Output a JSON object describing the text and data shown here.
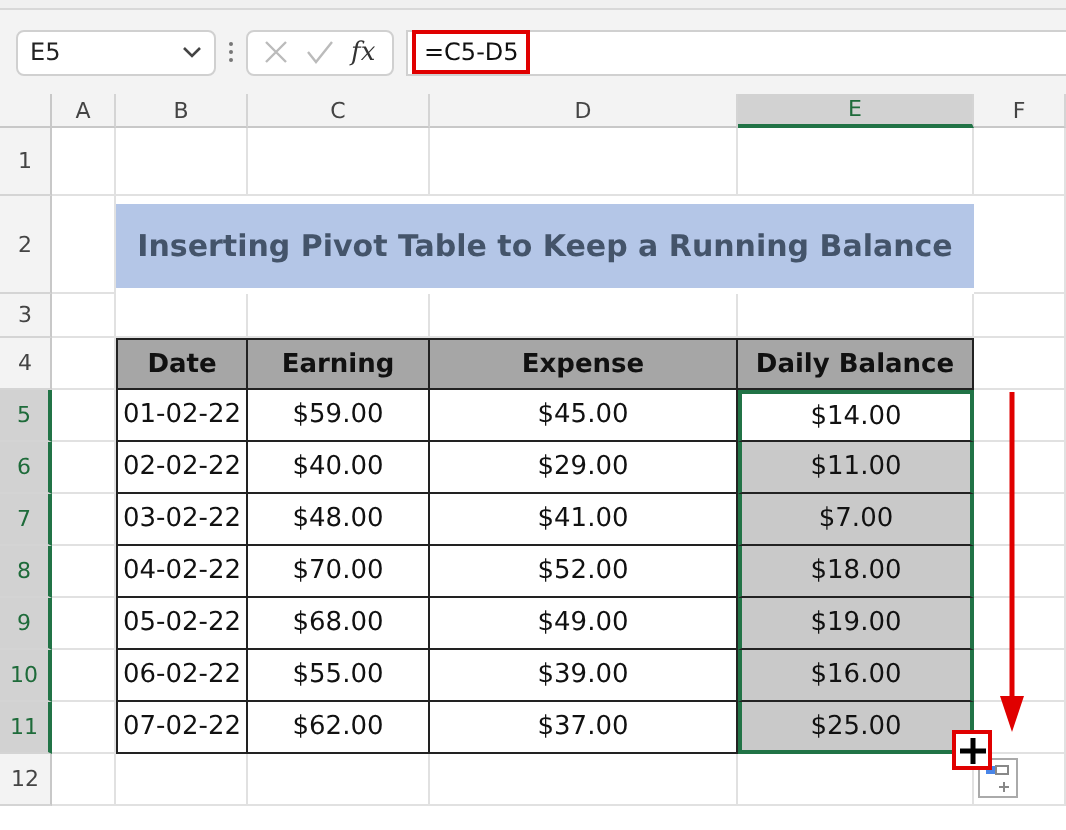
{
  "name_box": "E5",
  "function_label": "fx",
  "formula": "=C5-D5",
  "columns": [
    {
      "label": "A",
      "selected": false
    },
    {
      "label": "B",
      "selected": false
    },
    {
      "label": "C",
      "selected": false
    },
    {
      "label": "D",
      "selected": false
    },
    {
      "label": "E",
      "selected": true
    },
    {
      "label": "F",
      "selected": false
    }
  ],
  "row_numbers": [
    "1",
    "2",
    "3",
    "4",
    "5",
    "6",
    "7",
    "8",
    "9",
    "10",
    "11",
    "12"
  ],
  "title": "Inserting Pivot Table to Keep a Running Balance",
  "table": {
    "headers": [
      "Date",
      "Earning",
      "Expense",
      "Daily Balance"
    ],
    "rows": [
      {
        "date": "01-02-22",
        "earning": "$59.00",
        "expense": "$45.00",
        "balance": "$14.00",
        "active": true
      },
      {
        "date": "02-02-22",
        "earning": "$40.00",
        "expense": "$29.00",
        "balance": "$11.00",
        "active": false
      },
      {
        "date": "03-02-22",
        "earning": "$48.00",
        "expense": "$41.00",
        "balance": "$7.00",
        "active": false
      },
      {
        "date": "04-02-22",
        "earning": "$70.00",
        "expense": "$52.00",
        "balance": "$18.00",
        "active": false
      },
      {
        "date": "05-02-22",
        "earning": "$68.00",
        "expense": "$49.00",
        "balance": "$19.00",
        "active": false
      },
      {
        "date": "06-02-22",
        "earning": "$55.00",
        "expense": "$39.00",
        "balance": "$16.00",
        "active": false
      },
      {
        "date": "07-02-22",
        "earning": "$62.00",
        "expense": "$37.00",
        "balance": "$25.00",
        "active": false
      }
    ]
  }
}
